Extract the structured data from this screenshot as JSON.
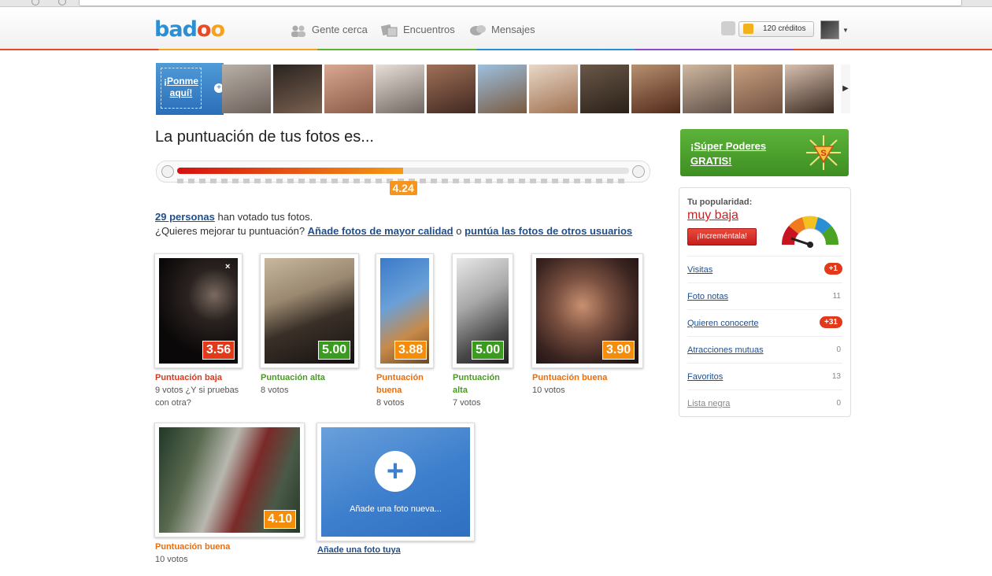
{
  "header": {
    "logo": {
      "b": "b",
      "a": "a",
      "d": "d",
      "o1": "o",
      "o2": "o"
    },
    "nav": [
      {
        "label": "Gente cerca",
        "icon": "people-icon"
      },
      {
        "label": "Encuentros",
        "icon": "encounters-icon"
      },
      {
        "label": "Mensajes",
        "icon": "messages-icon"
      }
    ],
    "credits": "120 créditos"
  },
  "strip": {
    "ponme_label": "¡Ponme aquí!"
  },
  "score": {
    "title": "La puntuación de tus fotos es...",
    "value": "4.24",
    "fraction": 0.5
  },
  "votes": {
    "people_link": "29 personas",
    "people_suffix": " han votado tus fotos.",
    "improve_prefix": "¿Quieres mejorar tu puntuación? ",
    "improve_link1": "Añade fotos de mayor calidad",
    "improve_or": " o ",
    "improve_link2": "puntúa las fotos de otros usuarios"
  },
  "photos": [
    {
      "score": "3.56",
      "label": "Puntuación baja",
      "votes": "9 votos  ¿Y si pruebas con otra?",
      "close": "×"
    },
    {
      "score": "5.00",
      "label": "Puntuación alta",
      "votes": "8 votos"
    },
    {
      "score": "3.88",
      "label": "Puntuación buena",
      "votes": "8 votos"
    },
    {
      "score": "5.00",
      "label": "Puntuación alta",
      "votes": "7 votos"
    },
    {
      "score": "3.90",
      "label": "Puntuación buena",
      "votes": "10 votos"
    },
    {
      "score": "4.10",
      "label": "Puntuación buena",
      "votes": "10 votos"
    }
  ],
  "add_photo": {
    "plus": "+",
    "tile_text": "Añade una foto nueva...",
    "link": "Añade una foto tuya"
  },
  "sidebar": {
    "super": {
      "line1": "¡Súper Poderes",
      "line2": "GRATIS!"
    },
    "popularity": {
      "label": "Tu popularidad:",
      "value": "muy baja",
      "button": "¡Increméntala!"
    },
    "stats": [
      {
        "label": "Visitas",
        "value": "+1",
        "pill": true
      },
      {
        "label": "Foto notas",
        "value": "11",
        "pill": false
      },
      {
        "label": "Quieren conocerte",
        "value": "+31",
        "pill": true
      },
      {
        "label": "Atracciones mutuas",
        "value": "0",
        "pill": false
      },
      {
        "label": "Favoritos",
        "value": "13",
        "pill": false
      },
      {
        "label": "Lista negra",
        "value": "0",
        "pill": false
      }
    ]
  }
}
